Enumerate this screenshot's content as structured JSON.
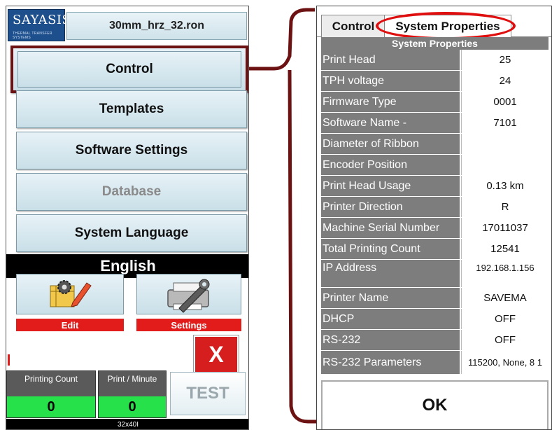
{
  "left_panel": {
    "logo": {
      "text": "SAYASIS",
      "sub": "THERMAL TRANSFER SYSTEMS"
    },
    "filename": "30mm_hrz_32.ron",
    "menu": {
      "control": "Control",
      "templates": "Templates",
      "software_settings": "Software Settings",
      "database": "Database",
      "system_language": "System Language"
    },
    "language": "English",
    "tiles": {
      "edit_label": "Edit",
      "settings_label": "Settings"
    },
    "close_label": "X",
    "stats": {
      "printing_count_label": "Printing Count",
      "printing_count_value": "0",
      "print_per_minute_label": "Print / Minute",
      "print_per_minute_value": "0"
    },
    "test_label": "TEST",
    "footer": "32x40I"
  },
  "right_panel": {
    "tabs": [
      {
        "label": "Control"
      },
      {
        "label": "System Properties"
      }
    ],
    "header": "System Properties",
    "rows": [
      {
        "name": "Print Head",
        "value": "25"
      },
      {
        "name": "TPH voltage",
        "value": "24"
      },
      {
        "name": "Firmware Type",
        "value": "0001"
      },
      {
        "name": "Software Name -",
        "value": "7101"
      },
      {
        "name": "Diameter of Ribbon",
        "value": ""
      },
      {
        "name": "Encoder Position",
        "value": ""
      },
      {
        "name": "Print Head Usage",
        "value": "0.13 km"
      },
      {
        "name": "Printer Direction",
        "value": "R"
      },
      {
        "name": "Machine Serial Number",
        "value": "17011037"
      },
      {
        "name": "Total Printing Count",
        "value": "12541"
      },
      {
        "name": "IP Address",
        "value": "192.168.1.156"
      },
      {
        "name": "Printer Name",
        "value": "SAVEMA"
      },
      {
        "name": "DHCP",
        "value": "OFF"
      },
      {
        "name": "RS-232",
        "value": "OFF"
      },
      {
        "name": "RS-232 Parameters",
        "value": "115200, None, 8 1"
      }
    ],
    "ok_label": "OK"
  },
  "colors": {
    "highlight_red": "#e00f0f",
    "connector_dark_red": "#6d1212",
    "button_face": "#d8e9f0",
    "label_gray": "#7d7d7d",
    "count_green": "#27e14a",
    "alert_red": "#e21b1b"
  }
}
